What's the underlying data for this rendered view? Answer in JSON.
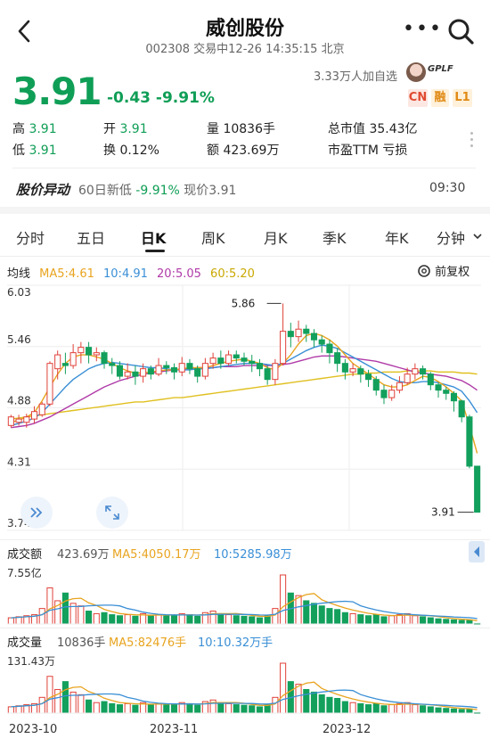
{
  "header": {
    "title": "威创股份",
    "subtitle": "002308 交易中12-26 14:35:15 北京",
    "more": "•••"
  },
  "quote": {
    "price": "3.91",
    "change": "-0.43",
    "change_pct": "-9.91%",
    "followers": "3.33万人加自选",
    "avatar_text": "GPLF",
    "badges": [
      "CN",
      "融",
      "L1"
    ]
  },
  "stats": [
    {
      "k": "高",
      "v": "3.91",
      "colored": true
    },
    {
      "k": "开",
      "v": "3.91",
      "colored": true
    },
    {
      "k": "量",
      "v": "10836手",
      "colored": false
    },
    {
      "k": "总市值",
      "v": "35.43亿",
      "colored": false
    },
    {
      "k": "低",
      "v": "3.91",
      "colored": true
    },
    {
      "k": "换",
      "v": "0.12%",
      "colored": false
    },
    {
      "k": "额",
      "v": "423.69万",
      "colored": false
    },
    {
      "k": "市盈TTM",
      "v": "亏损",
      "colored": false
    }
  ],
  "alert": {
    "tag": "股价异动",
    "text_prefix": "60日新低",
    "text_change": "-9.91%",
    "text_suffix": "现价3.91",
    "time": "09:30"
  },
  "tabs": [
    "分时",
    "五日",
    "日K",
    "周K",
    "月K",
    "季K",
    "年K",
    "分钟"
  ],
  "active_tab": "日K",
  "ma_legend": {
    "label": "均线",
    "ma5": "MA5:4.61",
    "ma10": "10:4.91",
    "ma20": "20:5.05",
    "ma60": "60:5.20",
    "adjust": "前复权"
  },
  "colors": {
    "up": "#e0413a",
    "down": "#12a05c",
    "ma5": "#e8a420",
    "ma10": "#3a8fd6",
    "ma20": "#b03aa8",
    "ma60": "#e0c020",
    "green": "#0f9e56"
  },
  "chart_data": [
    {
      "type": "candlestick",
      "title": "",
      "y_ticks": [
        "6.03",
        "5.46",
        "4.88",
        "4.31",
        "3.74"
      ],
      "ylim": [
        3.74,
        6.03
      ],
      "annotations": [
        {
          "label": "5.86",
          "value": 5.86
        },
        {
          "label": "3.91",
          "value": 3.91
        }
      ],
      "x_ticks": [
        "2023-10",
        "2023-11",
        "2023-12"
      ],
      "candles": [
        [
          4.72,
          4.8,
          4.7,
          4.82
        ],
        [
          4.75,
          4.78,
          4.72,
          4.82
        ],
        [
          4.75,
          4.8,
          4.7,
          4.83
        ],
        [
          4.78,
          4.85,
          4.74,
          4.9
        ],
        [
          4.82,
          4.92,
          4.8,
          4.94
        ],
        [
          4.92,
          5.3,
          4.9,
          5.32
        ],
        [
          5.25,
          5.38,
          5.15,
          5.42
        ],
        [
          5.3,
          5.28,
          5.2,
          5.4
        ],
        [
          5.28,
          5.4,
          5.25,
          5.48
        ],
        [
          5.4,
          5.45,
          5.3,
          5.5
        ],
        [
          5.45,
          5.38,
          5.3,
          5.5
        ],
        [
          5.38,
          5.4,
          5.32,
          5.45
        ],
        [
          5.4,
          5.3,
          5.25,
          5.42
        ],
        [
          5.3,
          5.28,
          5.2,
          5.35
        ],
        [
          5.28,
          5.18,
          5.15,
          5.32
        ],
        [
          5.18,
          5.22,
          5.15,
          5.3
        ],
        [
          5.22,
          5.18,
          5.1,
          5.28
        ],
        [
          5.18,
          5.25,
          5.12,
          5.3
        ],
        [
          5.25,
          5.2,
          5.15,
          5.28
        ],
        [
          5.2,
          5.28,
          5.18,
          5.35
        ],
        [
          5.28,
          5.26,
          5.2,
          5.32
        ],
        [
          5.26,
          5.22,
          5.15,
          5.3
        ],
        [
          5.22,
          5.3,
          5.18,
          5.36
        ],
        [
          5.3,
          5.25,
          5.2,
          5.34
        ],
        [
          5.25,
          5.18,
          5.12,
          5.28
        ],
        [
          5.18,
          5.3,
          5.15,
          5.35
        ],
        [
          5.3,
          5.35,
          5.25,
          5.4
        ],
        [
          5.35,
          5.3,
          5.25,
          5.42
        ],
        [
          5.3,
          5.38,
          5.28,
          5.42
        ],
        [
          5.38,
          5.35,
          5.3,
          5.42
        ],
        [
          5.35,
          5.32,
          5.28,
          5.4
        ],
        [
          5.32,
          5.3,
          5.22,
          5.38
        ],
        [
          5.3,
          5.25,
          5.18,
          5.34
        ],
        [
          5.25,
          5.15,
          5.1,
          5.28
        ],
        [
          5.15,
          5.3,
          5.1,
          5.34
        ],
        [
          5.3,
          5.6,
          5.28,
          5.86
        ],
        [
          5.6,
          5.55,
          5.45,
          5.68
        ],
        [
          5.55,
          5.62,
          5.5,
          5.7
        ],
        [
          5.62,
          5.58,
          5.5,
          5.66
        ],
        [
          5.58,
          5.52,
          5.45,
          5.62
        ],
        [
          5.52,
          5.48,
          5.4,
          5.56
        ],
        [
          5.48,
          5.4,
          5.3,
          5.52
        ],
        [
          5.4,
          5.3,
          5.22,
          5.44
        ],
        [
          5.3,
          5.22,
          5.15,
          5.34
        ],
        [
          5.22,
          5.25,
          5.18,
          5.3
        ],
        [
          5.25,
          5.2,
          5.12,
          5.28
        ],
        [
          5.2,
          5.15,
          5.08,
          5.24
        ],
        [
          5.15,
          5.05,
          5.0,
          5.18
        ],
        [
          5.05,
          4.98,
          4.92,
          5.1
        ],
        [
          4.98,
          5.05,
          4.95,
          5.1
        ],
        [
          5.05,
          5.12,
          5.02,
          5.18
        ],
        [
          5.12,
          5.2,
          5.1,
          5.26
        ],
        [
          5.2,
          5.25,
          5.15,
          5.3
        ],
        [
          5.25,
          5.2,
          5.15,
          5.28
        ],
        [
          5.2,
          5.1,
          5.05,
          5.22
        ],
        [
          5.1,
          5.05,
          4.98,
          5.12
        ],
        [
          5.05,
          5.02,
          4.96,
          5.08
        ],
        [
          5.02,
          4.95,
          4.85,
          5.04
        ],
        [
          4.95,
          4.8,
          4.75,
          4.96
        ],
        [
          4.8,
          4.34,
          4.32,
          4.82
        ],
        [
          4.34,
          3.91,
          3.91,
          3.91
        ]
      ],
      "ma5": [
        4.75,
        4.77,
        4.8,
        4.84,
        4.95,
        5.08,
        5.2,
        5.3,
        5.36,
        5.38,
        5.38,
        5.36,
        5.34,
        5.3,
        5.26,
        5.23,
        5.21,
        5.21,
        5.22,
        5.23,
        5.24,
        5.24,
        5.25,
        5.26,
        5.26,
        5.26,
        5.28,
        5.3,
        5.32,
        5.33,
        5.34,
        5.32,
        5.3,
        5.26,
        5.24,
        5.3,
        5.38,
        5.48,
        5.56,
        5.58,
        5.56,
        5.52,
        5.46,
        5.38,
        5.3,
        5.25,
        5.2,
        5.15,
        5.1,
        5.08,
        5.08,
        5.1,
        5.14,
        5.18,
        5.17,
        5.13,
        5.08,
        5.02,
        4.95,
        4.72,
        4.46
      ],
      "ma10": [
        4.72,
        4.74,
        4.76,
        4.79,
        4.84,
        4.92,
        5.0,
        5.08,
        5.15,
        5.2,
        5.25,
        5.28,
        5.3,
        5.31,
        5.3,
        5.29,
        5.28,
        5.27,
        5.26,
        5.26,
        5.25,
        5.24,
        5.24,
        5.24,
        5.25,
        5.25,
        5.26,
        5.27,
        5.28,
        5.29,
        5.3,
        5.3,
        5.3,
        5.29,
        5.28,
        5.3,
        5.34,
        5.38,
        5.42,
        5.45,
        5.47,
        5.46,
        5.44,
        5.4,
        5.36,
        5.32,
        5.28,
        5.24,
        5.2,
        5.16,
        5.13,
        5.12,
        5.12,
        5.13,
        5.13,
        5.12,
        5.1,
        5.08,
        5.04,
        4.95,
        4.84
      ],
      "ma20": [
        4.7,
        4.71,
        4.72,
        4.74,
        4.77,
        4.8,
        4.84,
        4.88,
        4.92,
        4.96,
        5.0,
        5.04,
        5.08,
        5.11,
        5.14,
        5.16,
        5.18,
        5.2,
        5.21,
        5.22,
        5.23,
        5.24,
        5.25,
        5.25,
        5.26,
        5.26,
        5.26,
        5.27,
        5.27,
        5.27,
        5.28,
        5.28,
        5.28,
        5.28,
        5.28,
        5.29,
        5.3,
        5.32,
        5.34,
        5.36,
        5.37,
        5.37,
        5.37,
        5.36,
        5.35,
        5.34,
        5.33,
        5.32,
        5.3,
        5.28,
        5.26,
        5.24,
        5.22,
        5.21,
        5.2,
        5.19,
        5.18,
        5.16,
        5.14,
        5.1,
        5.05
      ],
      "ma60": [
        4.78,
        4.79,
        4.8,
        4.81,
        4.82,
        4.83,
        4.84,
        4.85,
        4.86,
        4.87,
        4.88,
        4.89,
        4.9,
        4.91,
        4.92,
        4.93,
        4.94,
        4.94,
        4.95,
        4.96,
        4.97,
        4.98,
        4.98,
        4.99,
        5.0,
        5.01,
        5.02,
        5.03,
        5.04,
        5.05,
        5.06,
        5.07,
        5.08,
        5.09,
        5.1,
        5.11,
        5.12,
        5.13,
        5.14,
        5.15,
        5.16,
        5.17,
        5.18,
        5.19,
        5.2,
        5.2,
        5.21,
        5.21,
        5.22,
        5.22,
        5.22,
        5.23,
        5.23,
        5.23,
        5.23,
        5.22,
        5.22,
        5.22,
        5.21,
        5.21,
        5.2
      ]
    },
    {
      "type": "bar",
      "title": "成交额",
      "value": "423.69万",
      "ma5": "MA5:4050.17万",
      "ma10": "10:5285.98万",
      "ylabel": "7.55亿",
      "ylim": [
        0,
        7.55
      ]
    },
    {
      "type": "bar",
      "title": "成交量",
      "value": "10836手",
      "ma5": "MA5:82476手",
      "ma10": "10:10.32万手",
      "ylabel": "131.43万",
      "ylim": [
        0,
        131.43
      ],
      "volumes": [
        12,
        14,
        16,
        18,
        30,
        70,
        45,
        60,
        40,
        35,
        25,
        20,
        22,
        18,
        16,
        18,
        15,
        20,
        16,
        18,
        17,
        16,
        20,
        18,
        15,
        22,
        25,
        20,
        18,
        16,
        15,
        14,
        12,
        16,
        30,
        95,
        60,
        55,
        45,
        40,
        35,
        30,
        28,
        22,
        20,
        18,
        16,
        18,
        14,
        16,
        18,
        20,
        16,
        14,
        12,
        10,
        9,
        8,
        7,
        8,
        1
      ]
    }
  ]
}
